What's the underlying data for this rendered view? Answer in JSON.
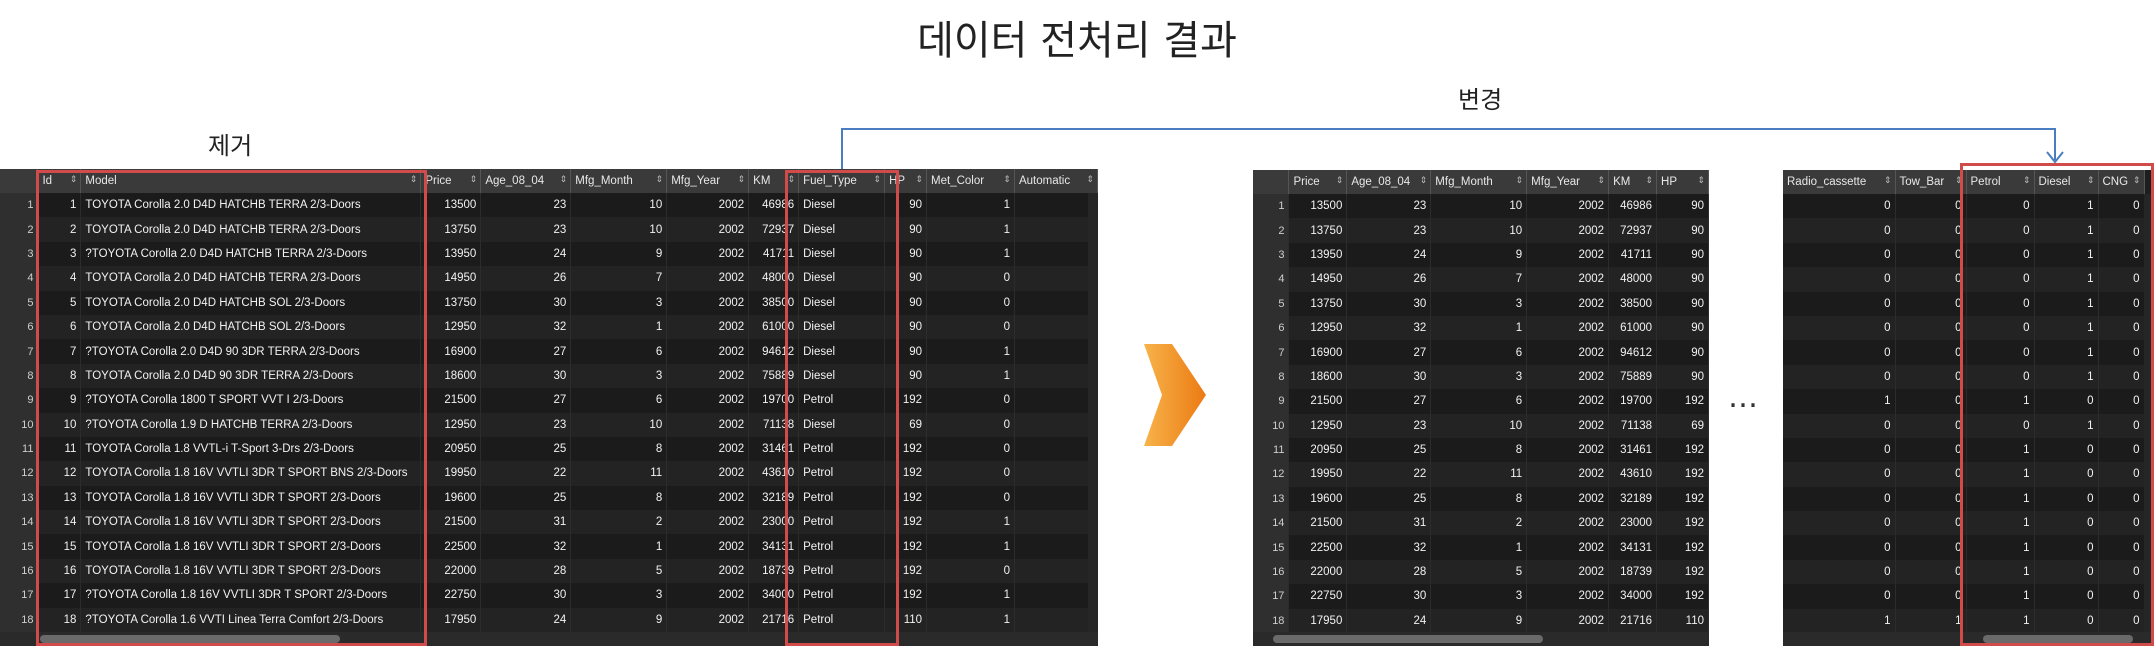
{
  "title": "데이터 전처리 결과",
  "labels": {
    "remove": "제거",
    "change": "변경",
    "ellipsis": "…"
  },
  "colors": {
    "highlight": "#d24b4b",
    "connector": "#4a7ec0",
    "arrow_light": "#f7b34a",
    "arrow_dark": "#ec7a13"
  },
  "left_table": {
    "columns": [
      "",
      "Id",
      "Model",
      "Price",
      "Age_08_04",
      "Mfg_Month",
      "Mfg_Year",
      "KM",
      "Fuel_Type",
      "HP",
      "Met_Color",
      "Automatic"
    ],
    "rows": [
      [
        "1",
        "1",
        "TOYOTA Corolla 2.0 D4D HATCHB TERRA 2/3-Doors",
        "13500",
        "23",
        "10",
        "2002",
        "46986",
        "Diesel",
        "90",
        "1",
        ""
      ],
      [
        "2",
        "2",
        "TOYOTA Corolla 2.0 D4D HATCHB TERRA 2/3-Doors",
        "13750",
        "23",
        "10",
        "2002",
        "72937",
        "Diesel",
        "90",
        "1",
        ""
      ],
      [
        "3",
        "3",
        "?TOYOTA Corolla 2.0 D4D HATCHB TERRA 2/3-Doors",
        "13950",
        "24",
        "9",
        "2002",
        "41711",
        "Diesel",
        "90",
        "1",
        ""
      ],
      [
        "4",
        "4",
        "TOYOTA Corolla 2.0 D4D HATCHB TERRA 2/3-Doors",
        "14950",
        "26",
        "7",
        "2002",
        "48000",
        "Diesel",
        "90",
        "0",
        ""
      ],
      [
        "5",
        "5",
        "TOYOTA Corolla 2.0 D4D HATCHB SOL 2/3-Doors",
        "13750",
        "30",
        "3",
        "2002",
        "38500",
        "Diesel",
        "90",
        "0",
        ""
      ],
      [
        "6",
        "6",
        "TOYOTA Corolla 2.0 D4D HATCHB SOL 2/3-Doors",
        "12950",
        "32",
        "1",
        "2002",
        "61000",
        "Diesel",
        "90",
        "0",
        ""
      ],
      [
        "7",
        "7",
        "?TOYOTA Corolla 2.0 D4D 90 3DR TERRA 2/3-Doors",
        "16900",
        "27",
        "6",
        "2002",
        "94612",
        "Diesel",
        "90",
        "1",
        ""
      ],
      [
        "8",
        "8",
        "TOYOTA Corolla 2.0 D4D 90 3DR TERRA 2/3-Doors",
        "18600",
        "30",
        "3",
        "2002",
        "75889",
        "Diesel",
        "90",
        "1",
        ""
      ],
      [
        "9",
        "9",
        "?TOYOTA Corolla 1800 T SPORT VVT I 2/3-Doors",
        "21500",
        "27",
        "6",
        "2002",
        "19700",
        "Petrol",
        "192",
        "0",
        ""
      ],
      [
        "10",
        "10",
        "?TOYOTA Corolla 1.9 D HATCHB TERRA 2/3-Doors",
        "12950",
        "23",
        "10",
        "2002",
        "71138",
        "Diesel",
        "69",
        "0",
        ""
      ],
      [
        "11",
        "11",
        "TOYOTA Corolla 1.8 VVTL-i T-Sport 3-Drs 2/3-Doors",
        "20950",
        "25",
        "8",
        "2002",
        "31461",
        "Petrol",
        "192",
        "0",
        ""
      ],
      [
        "12",
        "12",
        "TOYOTA Corolla 1.8 16V VVTLI 3DR T SPORT BNS 2/3-Doors",
        "19950",
        "22",
        "11",
        "2002",
        "43610",
        "Petrol",
        "192",
        "0",
        ""
      ],
      [
        "13",
        "13",
        "TOYOTA Corolla 1.8 16V VVTLI 3DR T SPORT 2/3-Doors",
        "19600",
        "25",
        "8",
        "2002",
        "32189",
        "Petrol",
        "192",
        "0",
        ""
      ],
      [
        "14",
        "14",
        "TOYOTA Corolla 1.8 16V VVTLI 3DR T SPORT 2/3-Doors",
        "21500",
        "31",
        "2",
        "2002",
        "23000",
        "Petrol",
        "192",
        "1",
        ""
      ],
      [
        "15",
        "15",
        "TOYOTA Corolla 1.8 16V VVTLI 3DR T SPORT 2/3-Doors",
        "22500",
        "32",
        "1",
        "2002",
        "34131",
        "Petrol",
        "192",
        "1",
        ""
      ],
      [
        "16",
        "16",
        "TOYOTA Corolla 1.8 16V VVTLI 3DR T SPORT 2/3-Doors",
        "22000",
        "28",
        "5",
        "2002",
        "18739",
        "Petrol",
        "192",
        "0",
        ""
      ],
      [
        "17",
        "17",
        "?TOYOTA Corolla 1.8 16V VVTLI 3DR T SPORT 2/3-Doors",
        "22750",
        "30",
        "3",
        "2002",
        "34000",
        "Petrol",
        "192",
        "1",
        ""
      ],
      [
        "18",
        "18",
        "?TOYOTA Corolla 1.6 VVTI Linea Terra Comfort 2/3-Doors",
        "17950",
        "24",
        "9",
        "2002",
        "21716",
        "Petrol",
        "110",
        "1",
        ""
      ]
    ]
  },
  "middle_table": {
    "columns": [
      "",
      "Price",
      "Age_08_04",
      "Mfg_Month",
      "Mfg_Year",
      "KM",
      "HP"
    ],
    "rows": [
      [
        "1",
        "13500",
        "23",
        "10",
        "2002",
        "46986",
        "90"
      ],
      [
        "2",
        "13750",
        "23",
        "10",
        "2002",
        "72937",
        "90"
      ],
      [
        "3",
        "13950",
        "24",
        "9",
        "2002",
        "41711",
        "90"
      ],
      [
        "4",
        "14950",
        "26",
        "7",
        "2002",
        "48000",
        "90"
      ],
      [
        "5",
        "13750",
        "30",
        "3",
        "2002",
        "38500",
        "90"
      ],
      [
        "6",
        "12950",
        "32",
        "1",
        "2002",
        "61000",
        "90"
      ],
      [
        "7",
        "16900",
        "27",
        "6",
        "2002",
        "94612",
        "90"
      ],
      [
        "8",
        "18600",
        "30",
        "3",
        "2002",
        "75889",
        "90"
      ],
      [
        "9",
        "21500",
        "27",
        "6",
        "2002",
        "19700",
        "192"
      ],
      [
        "10",
        "12950",
        "23",
        "10",
        "2002",
        "71138",
        "69"
      ],
      [
        "11",
        "20950",
        "25",
        "8",
        "2002",
        "31461",
        "192"
      ],
      [
        "12",
        "19950",
        "22",
        "11",
        "2002",
        "43610",
        "192"
      ],
      [
        "13",
        "19600",
        "25",
        "8",
        "2002",
        "32189",
        "192"
      ],
      [
        "14",
        "21500",
        "31",
        "2",
        "2002",
        "23000",
        "192"
      ],
      [
        "15",
        "22500",
        "32",
        "1",
        "2002",
        "34131",
        "192"
      ],
      [
        "16",
        "22000",
        "28",
        "5",
        "2002",
        "18739",
        "192"
      ],
      [
        "17",
        "22750",
        "30",
        "3",
        "2002",
        "34000",
        "192"
      ],
      [
        "18",
        "17950",
        "24",
        "9",
        "2002",
        "21716",
        "110"
      ]
    ]
  },
  "right_table": {
    "columns": [
      "Radio_cassette",
      "Tow_Bar",
      "Petrol",
      "Diesel",
      "CNG"
    ],
    "rows": [
      [
        "0",
        "0",
        "0",
        "1",
        "0"
      ],
      [
        "0",
        "0",
        "0",
        "1",
        "0"
      ],
      [
        "0",
        "0",
        "0",
        "1",
        "0"
      ],
      [
        "0",
        "0",
        "0",
        "1",
        "0"
      ],
      [
        "0",
        "0",
        "0",
        "1",
        "0"
      ],
      [
        "0",
        "0",
        "0",
        "1",
        "0"
      ],
      [
        "0",
        "0",
        "0",
        "1",
        "0"
      ],
      [
        "0",
        "0",
        "0",
        "1",
        "0"
      ],
      [
        "1",
        "0",
        "1",
        "0",
        "0"
      ],
      [
        "0",
        "0",
        "0",
        "1",
        "0"
      ],
      [
        "0",
        "0",
        "1",
        "0",
        "0"
      ],
      [
        "0",
        "0",
        "1",
        "0",
        "0"
      ],
      [
        "0",
        "0",
        "1",
        "0",
        "0"
      ],
      [
        "0",
        "0",
        "1",
        "0",
        "0"
      ],
      [
        "0",
        "0",
        "1",
        "0",
        "0"
      ],
      [
        "0",
        "0",
        "1",
        "0",
        "0"
      ],
      [
        "0",
        "0",
        "1",
        "0",
        "0"
      ],
      [
        "1",
        "1",
        "1",
        "0",
        "0"
      ]
    ]
  }
}
